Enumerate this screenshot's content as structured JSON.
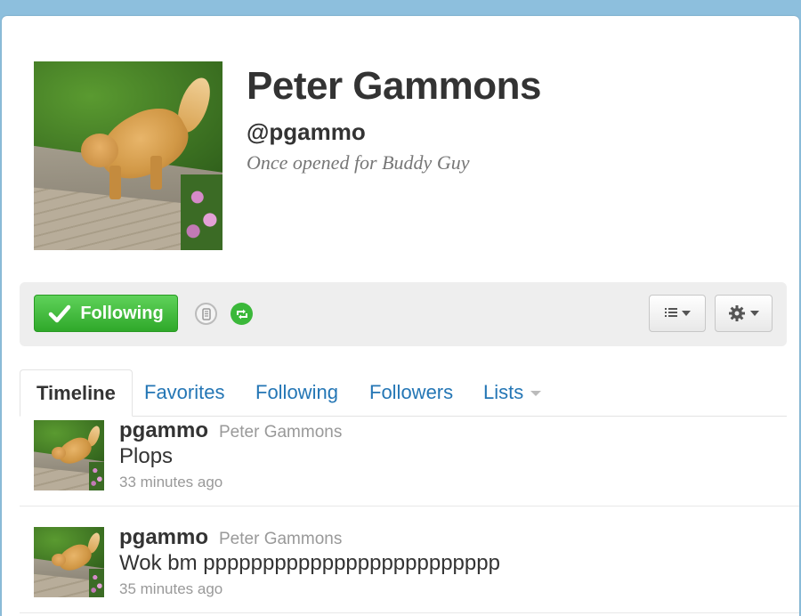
{
  "profile": {
    "name": "Peter Gammons",
    "handle": "@pgammo",
    "bio": "Once opened for Buddy Guy"
  },
  "actions": {
    "follow_label": "Following",
    "follow_color": "#3bb83a"
  },
  "icons": {
    "check": "check-icon",
    "device": "device-notification-icon",
    "retweet": "retweet-icon",
    "list": "list-icon",
    "gear": "gear-icon"
  },
  "tabs": [
    {
      "label": "Timeline",
      "active": true
    },
    {
      "label": "Favorites"
    },
    {
      "label": "Following"
    },
    {
      "label": "Followers"
    },
    {
      "label": "Lists"
    }
  ],
  "tweets": [
    {
      "screen_name": "pgammo",
      "full_name": "Peter Gammons",
      "text": "Plops",
      "time": "33 minutes ago"
    },
    {
      "screen_name": "pgammo",
      "full_name": "Peter Gammons",
      "text": "Wok bm ppppppppppppppppppppppppp",
      "time": "35 minutes ago"
    }
  ],
  "colors": {
    "background": "#8dbfdd",
    "link": "#2476b5",
    "follow_green": "#3bb83a"
  }
}
